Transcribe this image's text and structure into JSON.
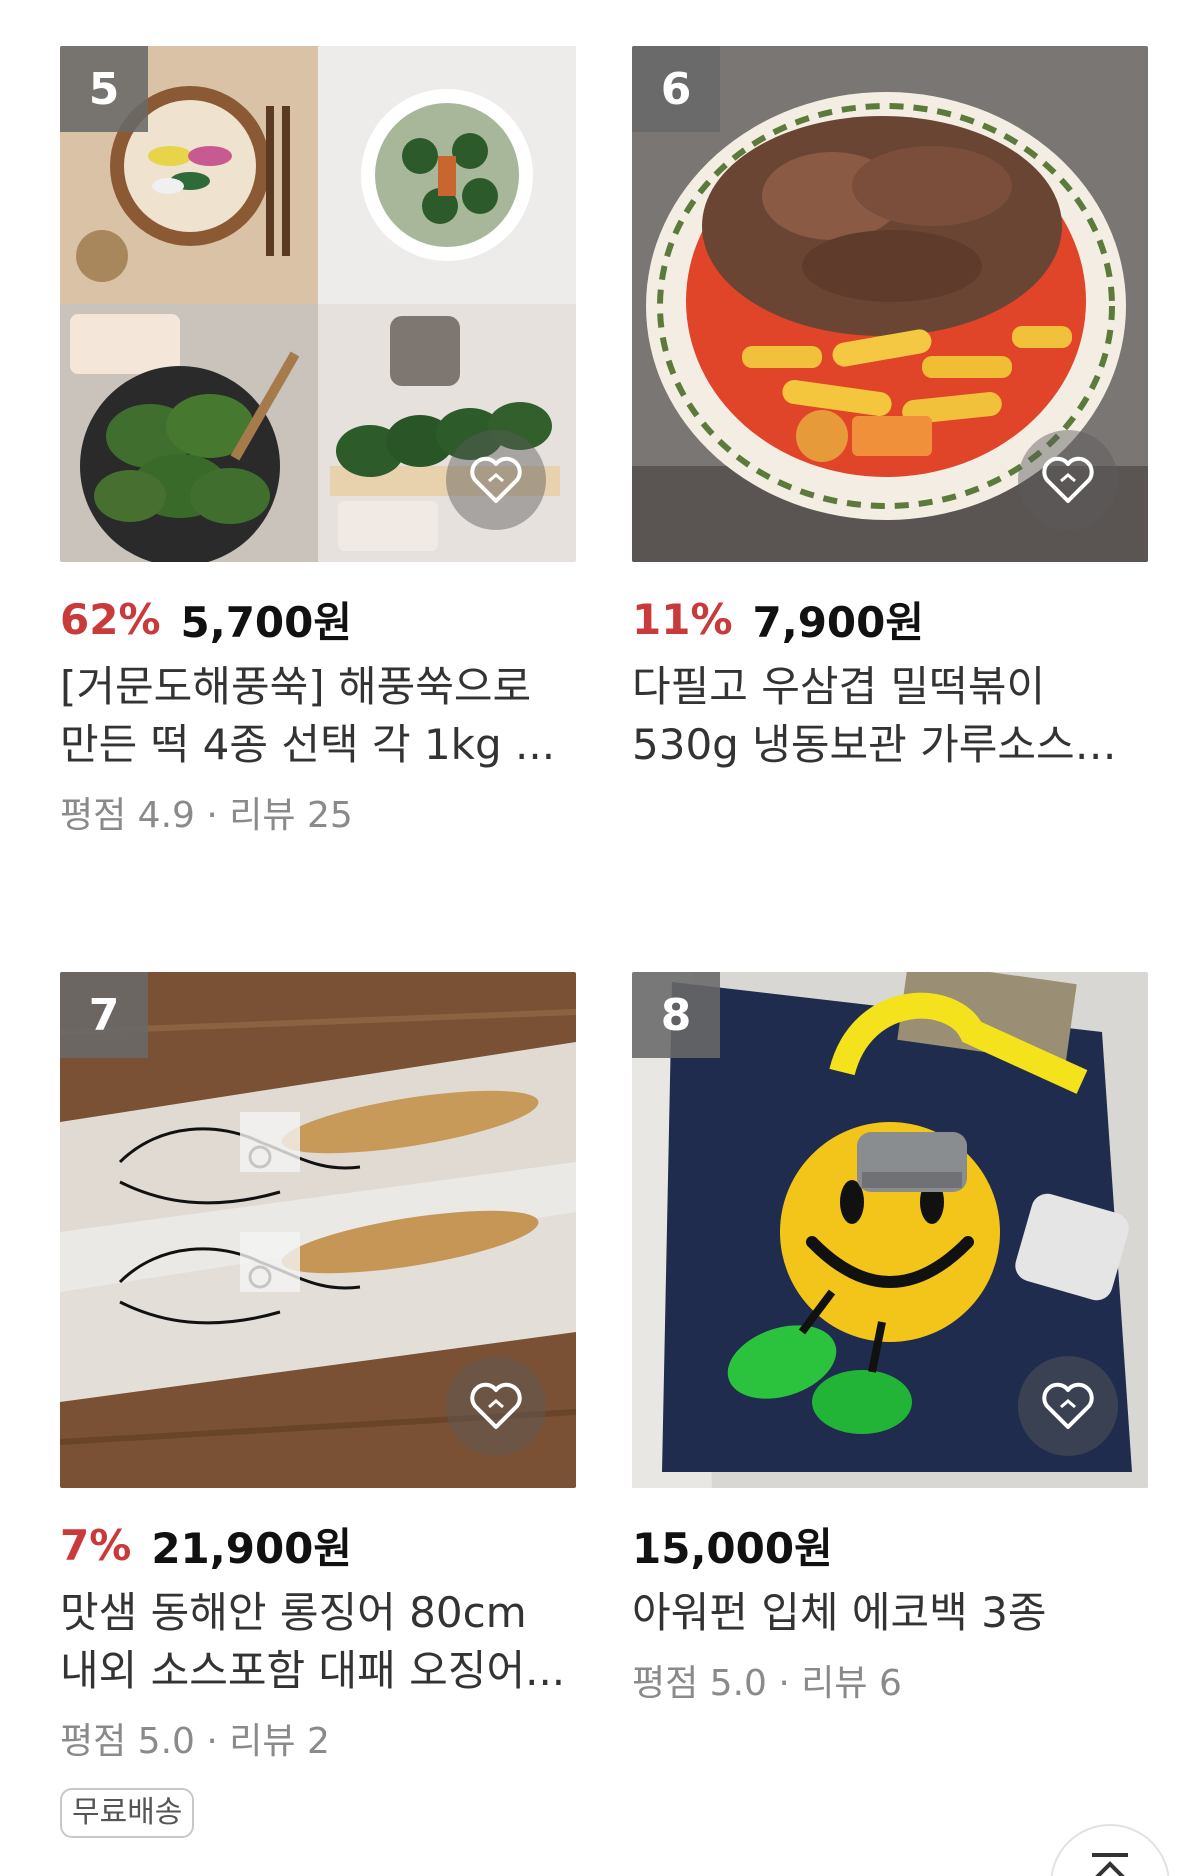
{
  "products": [
    {
      "rank": "5",
      "discount": "62%",
      "price": "5,700원",
      "title": "[거문도해풍쑥] 해풍쑥으로 만든 떡 4종 선택 각 1kg ...",
      "meta": "평점 4.9 · 리뷰 25",
      "badge": "",
      "image": "mugwort-rice-cakes-collage"
    },
    {
      "rank": "6",
      "discount": "11%",
      "price": "7,900원",
      "title": "다필고 우삼겹 밀떡볶이 530g 냉동보관 가루소스 떡...",
      "meta": "",
      "badge": "",
      "image": "beef-tteokbokki-plate"
    },
    {
      "rank": "7",
      "discount": "7%",
      "price": "21,900원",
      "title": "맛샘 동해안 롱징어 80cm 내외 소스포함 대패 오징어...",
      "meta": "평점 5.0 · 리뷰 2",
      "badge": "무료배송",
      "image": "dried-squid-packages"
    },
    {
      "rank": "8",
      "discount": "",
      "price": "15,000원",
      "title": "아워펀 입체 에코백 3종",
      "meta": "평점 5.0 · 리뷰 6",
      "badge": "",
      "image": "smiley-eco-bag"
    }
  ],
  "icons": {
    "wishlist": "heart-outline-icon",
    "scroll_top": "arrow-up-icon"
  },
  "colors": {
    "discount": "#c93a3a",
    "rank_badge": "#696969",
    "meta_text": "#8a8a8a"
  }
}
